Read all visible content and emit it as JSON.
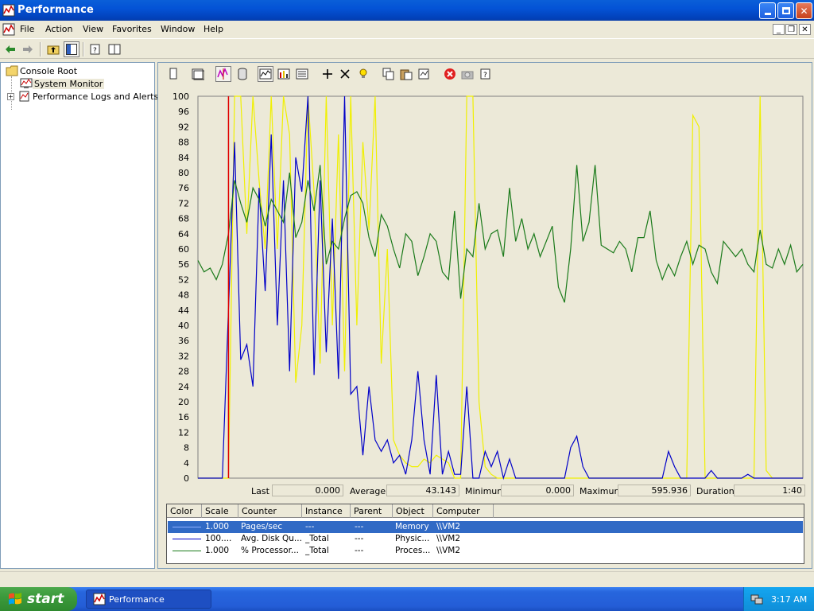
{
  "window": {
    "title": "Performance",
    "app_icon": "performance-icon",
    "buttons": [
      "minimize-icon",
      "restore-icon",
      "close-icon"
    ]
  },
  "menu": {
    "items": [
      "File",
      "Action",
      "View",
      "Favorites",
      "Window",
      "Help"
    ]
  },
  "toolbar": {
    "icons": [
      "back-arrow-icon",
      "forward-arrow-icon",
      "up-folder-icon",
      "show-hide-tree-icon",
      "properties-icon",
      "help-pane-icon"
    ]
  },
  "tree": {
    "items": [
      {
        "label": "Console Root",
        "icon": "folder-icon"
      },
      {
        "label": "System Monitor",
        "icon": "system-monitor-icon"
      },
      {
        "label": "Performance Logs and Alerts",
        "icon": "logs-alerts-icon"
      }
    ]
  },
  "sysmon_toolbar": {
    "icons": [
      "new-counter-set-icon",
      "clear-display-icon",
      "view-current-activity-icon",
      "view-log-data-icon",
      "view-graph-icon",
      "view-histogram-icon",
      "view-report-icon",
      "add-counter-icon",
      "delete-counter-icon",
      "highlight-icon",
      "copy-properties-icon",
      "paste-counter-list-icon",
      "properties-icon",
      "freeze-display-icon",
      "update-data-icon",
      "help-icon"
    ]
  },
  "statistics": {
    "last_label": "Last",
    "last_value": "0.000",
    "average_label": "Average",
    "average_value": "43.143",
    "minimum_label": "Minimum",
    "minimum_value": "0.000",
    "maximum_label": "Maximum",
    "maximum_value": "595.936",
    "duration_label": "Duration",
    "duration_value": "1:40"
  },
  "legend": {
    "columns": [
      "Color",
      "Scale",
      "Counter",
      "Instance",
      "Parent",
      "Object",
      "Computer"
    ],
    "rows": [
      {
        "color": "#4a6fd6",
        "scale": "1.000",
        "counter": "Pages/sec",
        "instance": "---",
        "parent": "---",
        "object": "Memory",
        "computer": "\\\\VM2"
      },
      {
        "color": "#0000c8",
        "scale": "100....",
        "counter": "Avg. Disk Qu...",
        "instance": "_Total",
        "parent": "---",
        "object": "Physic...",
        "computer": "\\\\VM2"
      },
      {
        "color": "#1a7a1a",
        "scale": "1.000",
        "counter": "% Processor...",
        "instance": "_Total",
        "parent": "---",
        "object": "Proces...",
        "computer": "\\\\VM2"
      }
    ]
  },
  "taskbar": {
    "start_label": "start",
    "task_label": "Performance",
    "clock": "3:17 AM",
    "tray_icon": "network-icon"
  },
  "chart_data": {
    "type": "line",
    "ylim": [
      0,
      100
    ],
    "yticks": [
      "100",
      "96",
      "92",
      "88",
      "84",
      "80",
      "76",
      "72",
      "68",
      "64",
      "60",
      "56",
      "52",
      "48",
      "44",
      "40",
      "36",
      "32",
      "28",
      "24",
      "20",
      "16",
      "12",
      "8",
      "4",
      "0"
    ],
    "points": 100,
    "series": [
      {
        "color": "#f0f000",
        "values": [
          0,
          0,
          0,
          0,
          0,
          0,
          100,
          100,
          64,
          100,
          78,
          60,
          100,
          60,
          100,
          90,
          25,
          40,
          100,
          75,
          30,
          100,
          40,
          90,
          28,
          100,
          40,
          88,
          65,
          100,
          30,
          60,
          10,
          6,
          4,
          3,
          3,
          5,
          4,
          6,
          5,
          4,
          0,
          0,
          100,
          100,
          20,
          3,
          1,
          0,
          0,
          0,
          0,
          0,
          0,
          0,
          0,
          0,
          0,
          0,
          0,
          0,
          0,
          0,
          0,
          0,
          0,
          0,
          0,
          0,
          0,
          0,
          0,
          0,
          0,
          0,
          0,
          0,
          0,
          0,
          0,
          95,
          92,
          0,
          0,
          0,
          0,
          0,
          0,
          0,
          0,
          0,
          100,
          2,
          0,
          0,
          0,
          0,
          0,
          0
        ]
      },
      {
        "color": "#0000c8",
        "values": [
          0,
          0,
          0,
          0,
          0,
          44,
          88,
          31,
          35,
          24,
          76,
          49,
          90,
          40,
          78,
          28,
          84,
          75,
          100,
          27,
          78,
          33,
          68,
          26,
          100,
          22,
          24,
          6,
          24,
          10,
          7,
          10,
          4,
          6,
          1,
          10,
          28,
          10,
          1,
          27,
          1,
          7,
          1,
          1,
          24,
          0,
          0,
          7,
          3,
          7,
          0,
          5,
          0,
          0,
          0,
          0,
          0,
          0,
          0,
          0,
          0,
          8,
          11,
          3,
          0,
          0,
          0,
          0,
          0,
          0,
          0,
          0,
          0,
          0,
          0,
          0,
          0,
          7,
          3,
          0,
          0,
          0,
          0,
          0,
          2,
          0,
          0,
          0,
          0,
          0,
          1,
          0,
          0,
          0,
          0,
          0,
          0,
          0,
          0,
          0
        ]
      },
      {
        "color": "#1a7a1a",
        "values": [
          57,
          54,
          55,
          52,
          56,
          64,
          78,
          72,
          67,
          76,
          73,
          66,
          73,
          70,
          67,
          80,
          63,
          67,
          78,
          70,
          82,
          56,
          62,
          60,
          68,
          74,
          75,
          72,
          63,
          58,
          69,
          66,
          60,
          55,
          64,
          62,
          53,
          58,
          64,
          62,
          54,
          52,
          70,
          47,
          60,
          58,
          72,
          60,
          64,
          65,
          58,
          76,
          62,
          68,
          60,
          64,
          58,
          62,
          66,
          50,
          46,
          60,
          82,
          62,
          67,
          82,
          61,
          60,
          59,
          62,
          60,
          54,
          63,
          63,
          70,
          57,
          52,
          56,
          53,
          58,
          62,
          56,
          61,
          60,
          54,
          51,
          62,
          60,
          58,
          60,
          56,
          54,
          65,
          56,
          55,
          60,
          56,
          61,
          54,
          56
        ]
      }
    ],
    "cursor_position": 5,
    "cursor_color": "#e00000"
  }
}
